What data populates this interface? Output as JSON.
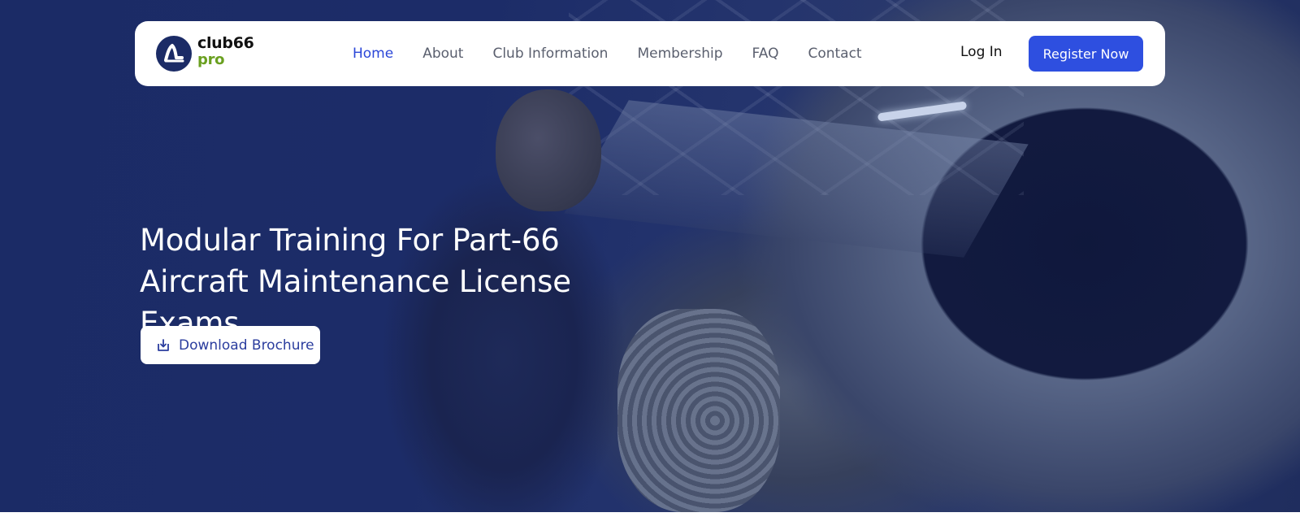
{
  "brand": {
    "name_line1": "club66",
    "name_line2": "pro",
    "primary_color": "#1b2b66",
    "accent_color": "#6aa020"
  },
  "nav": {
    "items": [
      {
        "label": "Home",
        "active": true
      },
      {
        "label": "About",
        "active": false
      },
      {
        "label": "Club Information",
        "active": false
      },
      {
        "label": "Membership",
        "active": false
      },
      {
        "label": "FAQ",
        "active": false
      },
      {
        "label": "Contact",
        "active": false
      }
    ],
    "login_label": "Log In",
    "register_label": "Register Now",
    "register_color": "#2e4fe0",
    "active_color": "#2b47d8"
  },
  "hero": {
    "title_line1": "Modular Training For Part-66",
    "title_line2": "Aircraft Maintenance License Exams",
    "download_label": "Download Brochure",
    "download_icon": "download-icon",
    "background": "aircraft-engine-maintenance-photo"
  }
}
